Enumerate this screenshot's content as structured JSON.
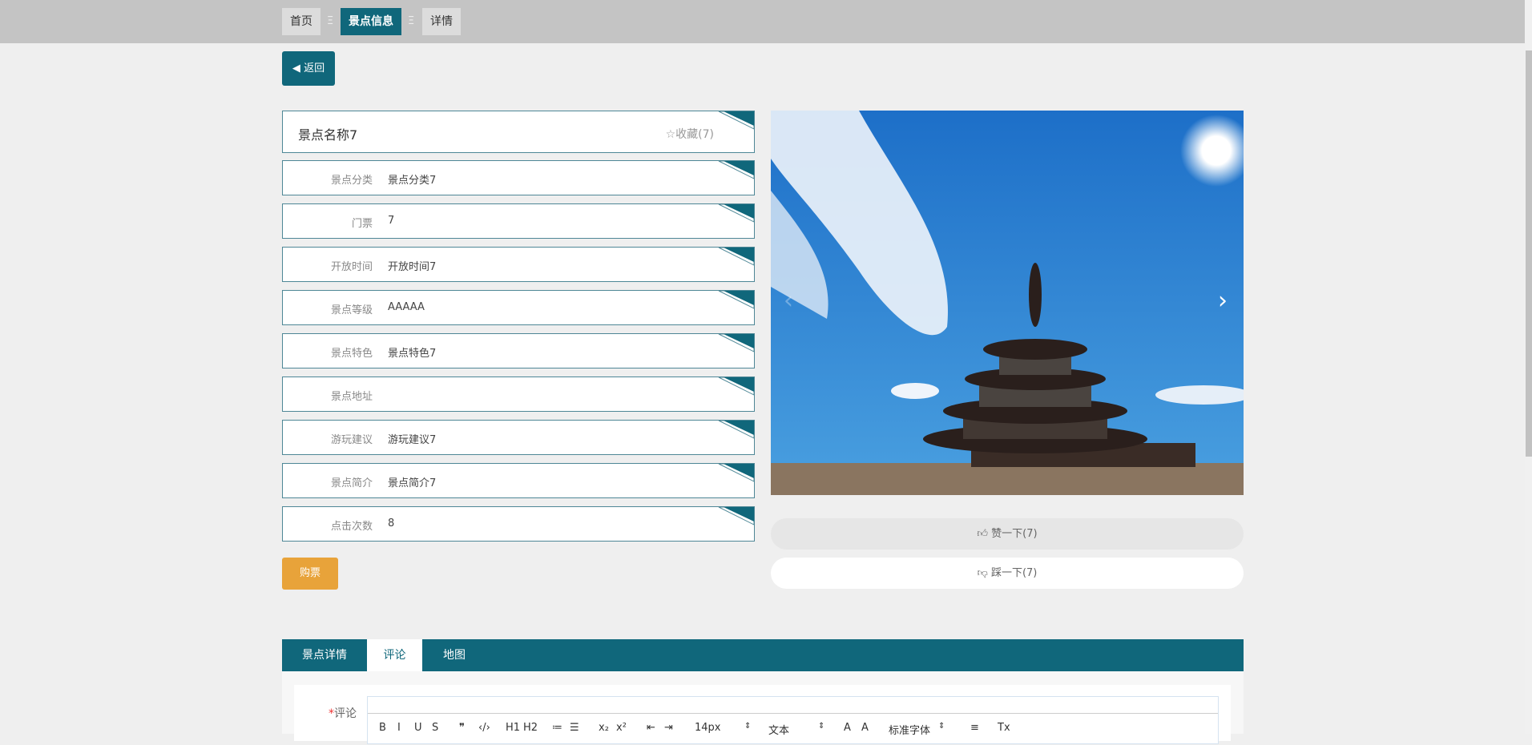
{
  "breadcrumb": {
    "items": [
      "首页",
      "景点信息",
      "详情"
    ],
    "separator": "Ξ"
  },
  "back_label": "返回",
  "spot": {
    "name": "景点名称7",
    "favorite": "收藏(7)"
  },
  "fields": [
    {
      "label": "景点分类",
      "value": "景点分类7"
    },
    {
      "label": "门票",
      "value": "7"
    },
    {
      "label": "开放时间",
      "value": "开放时间7"
    },
    {
      "label": "景点等级",
      "value": "AAAAA"
    },
    {
      "label": "景点特色",
      "value": "景点特色7"
    },
    {
      "label": "景点地址",
      "value": ""
    },
    {
      "label": "游玩建议",
      "value": "游玩建议7"
    },
    {
      "label": "景点简介",
      "value": "景点简介7"
    },
    {
      "label": "点击次数",
      "value": "8"
    }
  ],
  "buy_label": "购票",
  "like_label": "赞一下(7)",
  "dislike_label": "踩一下(7)",
  "tabs": [
    "景点详情",
    "评论",
    "地图"
  ],
  "comment": {
    "label": "评论",
    "required_mark": "*"
  },
  "toolbar": {
    "font_size": "14px",
    "paragraph": "文本",
    "font_family": "标准字体",
    "buttons": [
      "B",
      "I",
      "U",
      "S",
      "❞",
      "‹/›",
      "H1",
      "H2",
      "≔",
      "☰",
      "x₂",
      "x²",
      "⇤",
      "⇥",
      "A",
      "A",
      "≡",
      "Tx"
    ]
  },
  "colors": {
    "primary": "#10677b",
    "buy": "#e8a33a"
  }
}
